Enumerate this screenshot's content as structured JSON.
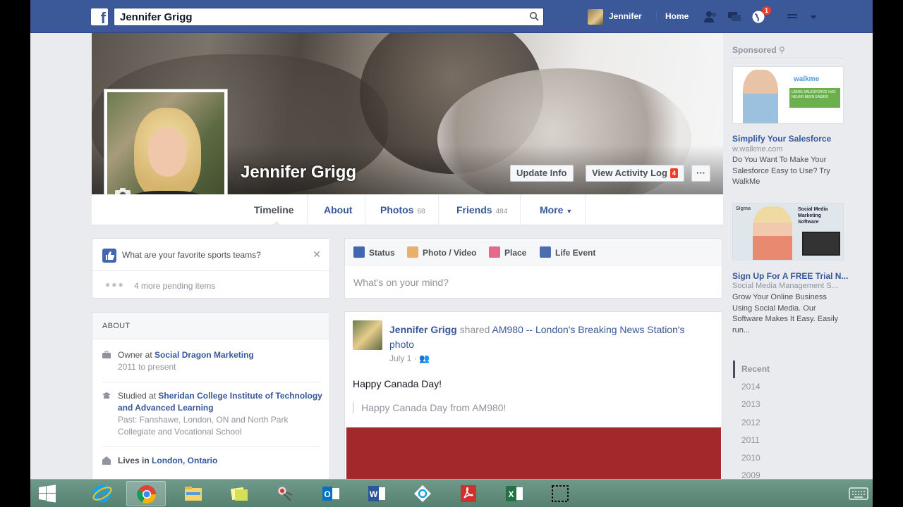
{
  "topbar": {
    "logo": "f",
    "search_value": "Jennifer Grigg",
    "user_name": "Jennifer",
    "home_label": "Home",
    "notification_count": "1"
  },
  "cover": {
    "name": "Jennifer Grigg",
    "update_info_label": "Update Info",
    "activity_log_label": "View Activity Log",
    "activity_log_count": "4",
    "more_label": "···"
  },
  "tabs": [
    {
      "label": "Timeline",
      "count": ""
    },
    {
      "label": "About",
      "count": ""
    },
    {
      "label": "Photos",
      "count": "68"
    },
    {
      "label": "Friends",
      "count": "484"
    },
    {
      "label": "More",
      "count": ""
    }
  ],
  "pending": {
    "question": "What are your favorite sports teams?",
    "close": "✕",
    "more_items": "4 more pending items"
  },
  "about": {
    "heading": "ABOUT",
    "work_prefix": "Owner at",
    "work_place": "Social Dragon Marketing",
    "work_years": "2011 to present",
    "edu_prefix": "Studied at",
    "edu_school": "Sheridan College Institute of Technology and Advanced Learning",
    "edu_past": "Past: Fanshawe, London, ON and North Park Collegiate and Vocational School",
    "lives_prefix": "Lives in",
    "lives_place": "London, Ontario"
  },
  "composer": {
    "tabs": [
      "Status",
      "Photo / Video",
      "Place",
      "Life Event"
    ],
    "placeholder": "What's on your mind?"
  },
  "post": {
    "author": "Jennifer Grigg",
    "action": "shared",
    "source": "AM980 -- London's Breaking News Station's",
    "object": "photo",
    "date": "July 1",
    "text": "Happy Canada Day!",
    "quote": "Happy Canada Day from AM980!"
  },
  "sidebar": {
    "sponsored_label": "Sponsored",
    "ads": [
      {
        "title": "Simplify Your Salesforce",
        "domain": "w.walkme.com",
        "body": "Do You Want To Make Your Salesforce Easy to Use? Try WalkMe",
        "image_brand": "walkme",
        "image_caption": "USING SALESFORCE HAS NEVER BEEN EASIER"
      },
      {
        "title": "Sign Up For A FREE Trial N...",
        "domain": "Social Media Management S...",
        "body": "Grow Your Online Business Using Social Media. Our Software Makes It Easy. Easily run...",
        "image_brand": "Sigma",
        "image_caption": "Social Media Marketing Software"
      }
    ],
    "years": [
      "Recent",
      "2014",
      "2013",
      "2012",
      "2011",
      "2010",
      "2009"
    ]
  },
  "colors": {
    "facebook_blue": "#3b5998",
    "link_blue": "#365899",
    "page_bg": "#e9ebee",
    "badge_red": "#f03d25",
    "taskbar": "#6f9a8b"
  },
  "taskbar": {
    "apps": [
      "internet-explorer",
      "chrome",
      "file-explorer",
      "sticky-notes",
      "snipping-tool",
      "outlook",
      "word",
      "ie-app",
      "acrobat",
      "excel",
      "screen-capture"
    ]
  }
}
